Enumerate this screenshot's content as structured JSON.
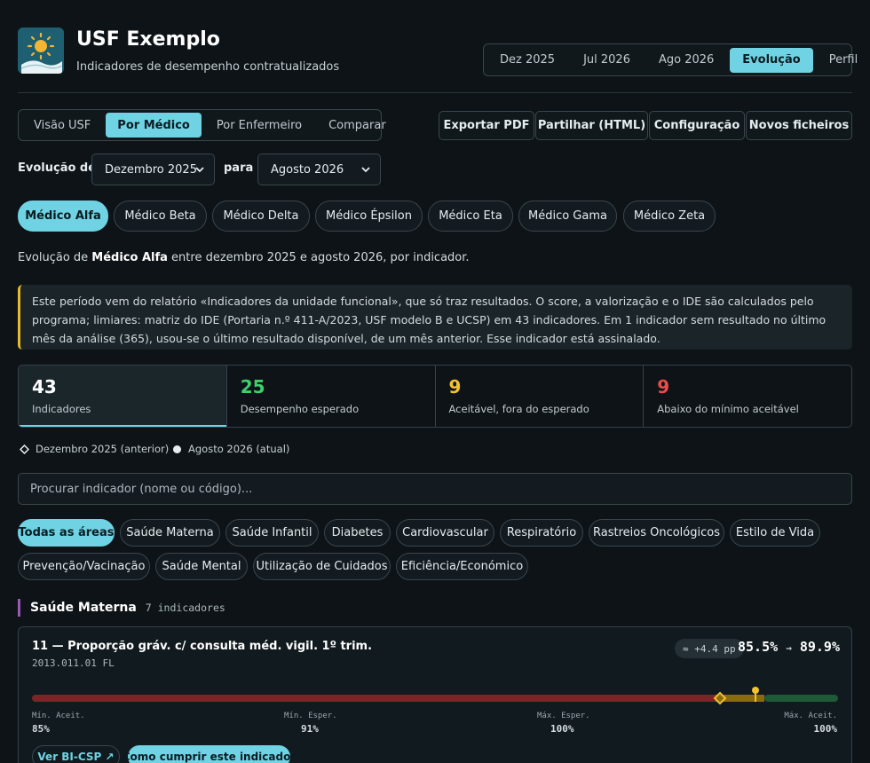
{
  "header": {
    "title": "USF Exemplo",
    "subtitle": "Indicadores de desempenho contratualizados",
    "period_tabs": [
      "Dez 2025",
      "Jul 2026",
      "Ago 2026",
      "Evolução",
      "Perfil"
    ],
    "active_period_tab": "Evolução"
  },
  "toolbar": {
    "view_tabs": [
      "Visão USF",
      "Por Médico",
      "Por Enfermeiro",
      "Comparar"
    ],
    "active_view_tab": "Por Médico",
    "export_pdf": "Exportar PDF",
    "share_html": "Partilhar (HTML)",
    "settings": "Configuração",
    "new_files": "Novos ficheiros"
  },
  "evolution": {
    "from_label": "Evolução de",
    "from_value": "Dezembro 2025",
    "to_label": "para",
    "to_value": "Agosto 2026"
  },
  "doctors": [
    "Médico Alfa",
    "Médico Beta",
    "Médico Delta",
    "Médico Épsilon",
    "Médico Eta",
    "Médico Gama",
    "Médico Zeta"
  ],
  "active_doctor": "Médico Alfa",
  "intro": {
    "prefix": "Evolução de ",
    "name": "Médico Alfa",
    "suffix": " entre dezembro 2025 e agosto 2026, por indicador."
  },
  "notice": "Este período vem do relatório «Indicadores da unidade funcional», que só traz resultados. O score, a valorização e o IDE são calculados pelo programa; limiares: matriz do IDE (Portaria n.º 411-A/2023, USF modelo B e UCSP) em 43 indicadores. Em 1 indicador sem resultado no último mês da análise (365), usou-se o último resultado disponível, de um mês anterior. Esse indicador está assinalado.",
  "stats": [
    {
      "value": "43",
      "caption": "Indicadores",
      "color": "#ffffff"
    },
    {
      "value": "25",
      "caption": "Desempenho esperado",
      "color": "#3fcf6b"
    },
    {
      "value": "9",
      "caption": "Aceitável, fora do esperado",
      "color": "#f2c12e"
    },
    {
      "value": "9",
      "caption": "Abaixo do mínimo aceitável",
      "color": "#ec4b4b"
    }
  ],
  "legend": {
    "previous": "Dezembro 2025 (anterior)",
    "current": "Agosto 2026 (atual)"
  },
  "search": {
    "placeholder": "Procurar indicador (nome ou código)..."
  },
  "areas": [
    "Todas as áreas",
    "Saúde Materna",
    "Saúde Infantil",
    "Diabetes",
    "Cardiovascular",
    "Respiratório",
    "Rastreios Oncológicos",
    "Estilo de Vida",
    "Prevenção/Vacinação",
    "Saúde Mental",
    "Utilização de Cuidados",
    "Eficiência/Económico"
  ],
  "active_area": "Todas as áreas",
  "section": {
    "title": "Saúde Materna",
    "count": "7 indicadores"
  },
  "indicator": {
    "title": "11 — Proporção gráv. c/ consulta méd. vigil. 1º trim.",
    "code": "2013.011.01 FL",
    "delta": "≈ +4.4 pp",
    "previous_value": "85.5%",
    "arrow": "→",
    "current_value": "89.9%",
    "previous_fraction": 0.855,
    "current_fraction": 0.899,
    "thresholds": [
      {
        "label": "Mín. Aceit.",
        "value": "85%"
      },
      {
        "label": "Mín. Esper.",
        "value": "91%"
      },
      {
        "label": "Máx. Esper.",
        "value": "100%"
      },
      {
        "label": "Máx. Aceit.",
        "value": "100%"
      }
    ],
    "bi_button": "Ver BI-CSP ↗",
    "howto_button": "Como cumprir este indicador"
  },
  "colors": {
    "accent": "#6fd3e3",
    "red_zone": "#7a2626",
    "amber_zone": "#8a6a10",
    "green_zone": "#1f5a36",
    "marker": "#f2c12e"
  }
}
